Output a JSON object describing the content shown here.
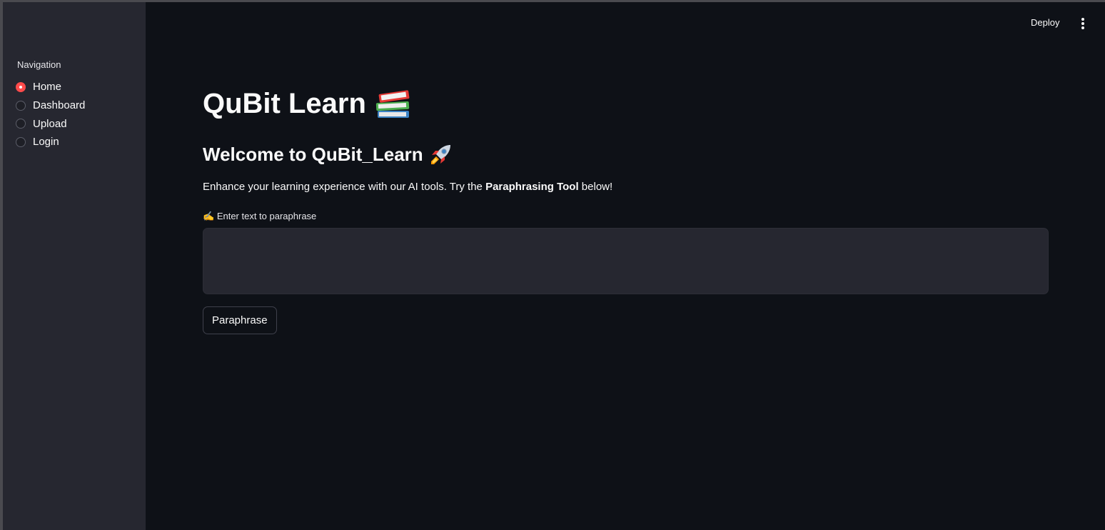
{
  "sidebar": {
    "nav_title": "Navigation",
    "items": [
      {
        "label": "Home",
        "selected": true
      },
      {
        "label": "Dashboard",
        "selected": false
      },
      {
        "label": "Upload",
        "selected": false
      },
      {
        "label": "Login",
        "selected": false
      }
    ]
  },
  "topbar": {
    "deploy_label": "Deploy",
    "menu_icon": "vertical-ellipsis-icon"
  },
  "main": {
    "title": "QuBit Learn",
    "title_icon": "books-icon",
    "welcome": "Welcome to QuBit_Learn",
    "welcome_icon": "rocket-icon",
    "description_pre": "Enhance your learning experience with our AI tools. Try the ",
    "description_bold": "Paraphrasing Tool",
    "description_post": " below!",
    "field_label_icon": "✍️",
    "field_label": "Enter text to paraphrase",
    "textarea_value": "",
    "button_label": "Paraphrase"
  },
  "colors": {
    "app_bg": "#0e1117",
    "sidebar_bg": "#262730",
    "accent": "#ff4b4b",
    "text": "#fafafa"
  }
}
